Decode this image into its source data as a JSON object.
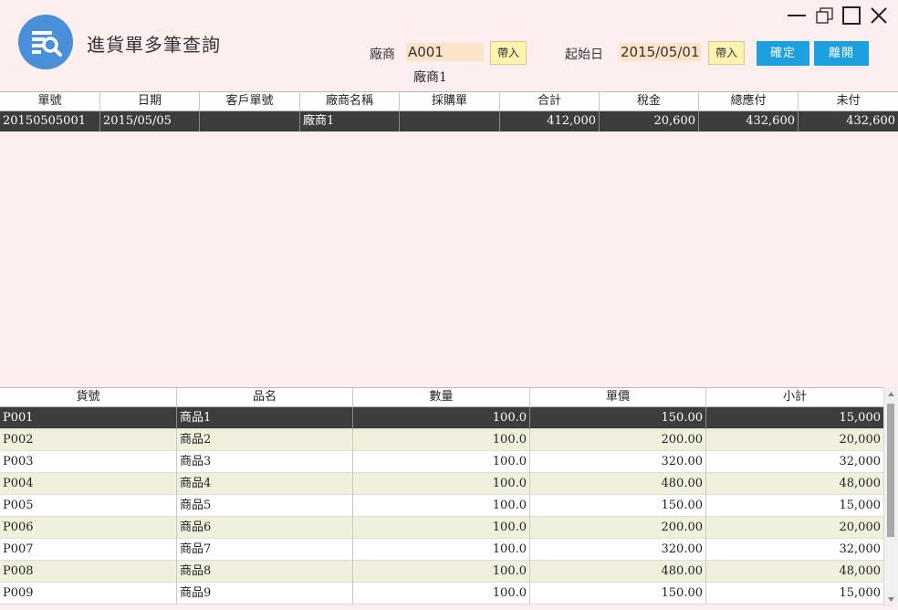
{
  "window": {
    "title": "進貨單多筆查詢",
    "controls": [
      "minimize-icon",
      "restore-icon",
      "maximize-icon",
      "close-icon"
    ]
  },
  "filters": {
    "vendor_label": "廠商",
    "vendor_code": "A001",
    "vendor_import_label": "帶入",
    "vendor_name": "廠商1",
    "start_date_label": "起始日",
    "start_date": "2015/05/01",
    "date_import_label": "帶入"
  },
  "actions": {
    "confirm_label": "確定",
    "exit_label": "離開"
  },
  "orders_table": {
    "headers": [
      "單號",
      "日期",
      "客戶單號",
      "廠商名稱",
      "採購單",
      "合計",
      "稅金",
      "總應付",
      "未付"
    ],
    "rows": [
      [
        "20150505001",
        "2015/05/05",
        "",
        "廠商1",
        "",
        "412,000",
        "20,600",
        "432,600",
        "432,600"
      ]
    ]
  },
  "items_table": {
    "headers": [
      "貨號",
      "品名",
      "數量",
      "單價",
      "小計"
    ],
    "rows": [
      [
        "P001",
        "商品1",
        "100.0",
        "150.00",
        "15,000"
      ],
      [
        "P002",
        "商品2",
        "100.0",
        "200.00",
        "20,000"
      ],
      [
        "P003",
        "商品3",
        "100.0",
        "320.00",
        "32,000"
      ],
      [
        "P004",
        "商品4",
        "100.0",
        "480.00",
        "48,000"
      ],
      [
        "P005",
        "商品5",
        "100.0",
        "150.00",
        "15,000"
      ],
      [
        "P006",
        "商品6",
        "100.0",
        "200.00",
        "20,000"
      ],
      [
        "P007",
        "商品7",
        "100.0",
        "320.00",
        "32,000"
      ],
      [
        "P008",
        "商品8",
        "100.0",
        "480.00",
        "48,000"
      ],
      [
        "P009",
        "商品9",
        "100.0",
        "150.00",
        "15,000"
      ]
    ]
  },
  "colors": {
    "background": "#fdeef0",
    "accent": "#1ca0e0",
    "icon_bg": "#4a90d9",
    "selected_row": "#3d3d3d",
    "alt_row": "#f0f0dc",
    "field_bg": "#fde3c8",
    "import_btn_bg": "#fdf3b0"
  }
}
